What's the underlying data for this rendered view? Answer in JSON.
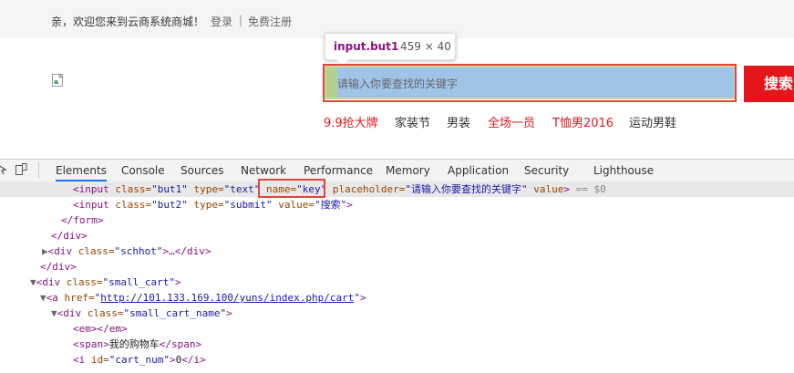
{
  "topbar": {
    "welcome": "亲，欢迎您来到云商系统商城！",
    "login": "登录",
    "separator": "|",
    "register": "免费注册"
  },
  "tooltip": {
    "tag": "input.but1",
    "size": "459 × 40"
  },
  "search": {
    "placeholder": "请输入你要查找的关键字",
    "button_label": "搜索"
  },
  "hotwords": [
    "9.9抢大牌",
    "家装节",
    "男装",
    "全场一员",
    "T恤男2016",
    "运动男鞋"
  ],
  "devtools": {
    "tabs": [
      "Elements",
      "Console",
      "Sources",
      "Network",
      "Performance",
      "Memory",
      "Application",
      "Security",
      "Lighthouse"
    ],
    "active_tab": "Elements"
  },
  "code": {
    "l1_tag_open": "<input",
    "l1_class_attr": " class=",
    "l1_class_val": "\"but1\"",
    "l1_type_attr": " type=",
    "l1_type_val": "\"text\"",
    "l1_name_attr": " name=",
    "l1_name_val": "\"key\"",
    "l1_ph_attr": " placeholder=",
    "l1_ph_val": "\"请输入你要查找的关键字\"",
    "l1_value_attr": " value",
    "l1_close": ">",
    "l1_suffix": " == $0",
    "l2_tag_open": "<input",
    "l2_class_attr": " class=",
    "l2_class_val": "\"but2\"",
    "l2_type_attr": " type=",
    "l2_type_val": "\"submit\"",
    "l2_value_attr": " value=",
    "l2_value_val": "\"搜索\"",
    "l2_close": ">",
    "l3": "</form>",
    "l4": "</div>",
    "l5_tag": "<div",
    "l5_attr": " class=",
    "l5_val": "\"schhot\"",
    "l5_rest": ">…</div>",
    "l6": "</div>",
    "l7_tag": "<div",
    "l7_attr": " class=",
    "l7_val": "\"small_cart\"",
    "l7_close": ">",
    "l8_tag": "<a",
    "l8_attr": " href=",
    "l8_q1": "\"",
    "l8_url": "http://101.133.169.100/yuns/index.php/cart",
    "l8_q2": "\"",
    "l8_close": ">",
    "l9_tag": "<div",
    "l9_attr": " class=",
    "l9_val": "\"small_cart_name\"",
    "l9_close": ">",
    "l10": "<em></em>",
    "l11_open": "<span>",
    "l11_text": "我的购物车",
    "l11_close": "</span>",
    "l12_tag": "<i",
    "l12_attr": " id=",
    "l12_val": "\"cart_num\"",
    "l12_gt": ">",
    "l12_text": "0",
    "l12_close": "</i>"
  }
}
